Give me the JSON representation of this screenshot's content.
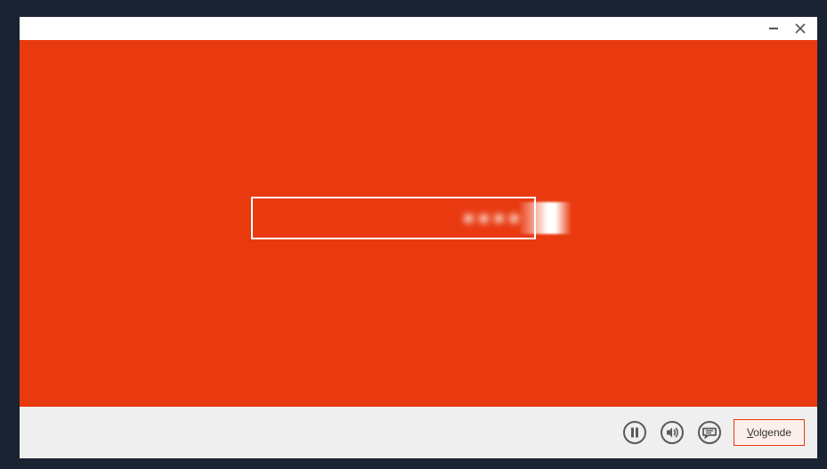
{
  "colors": {
    "accent": "#e8390f",
    "footer_bg": "#efefef",
    "window_bg": "#ffffff",
    "desktop_bg": "#1a2332"
  },
  "footer": {
    "next_label_prefix": "V",
    "next_label_rest": "olgende",
    "pause_icon_name": "pause-icon",
    "sound_icon_name": "sound-icon",
    "feedback_icon_name": "feedback-icon"
  },
  "titlebar": {
    "minimize_icon_name": "minimize-icon",
    "close_icon_name": "close-icon"
  },
  "progress": {
    "approx_percent": 100
  }
}
